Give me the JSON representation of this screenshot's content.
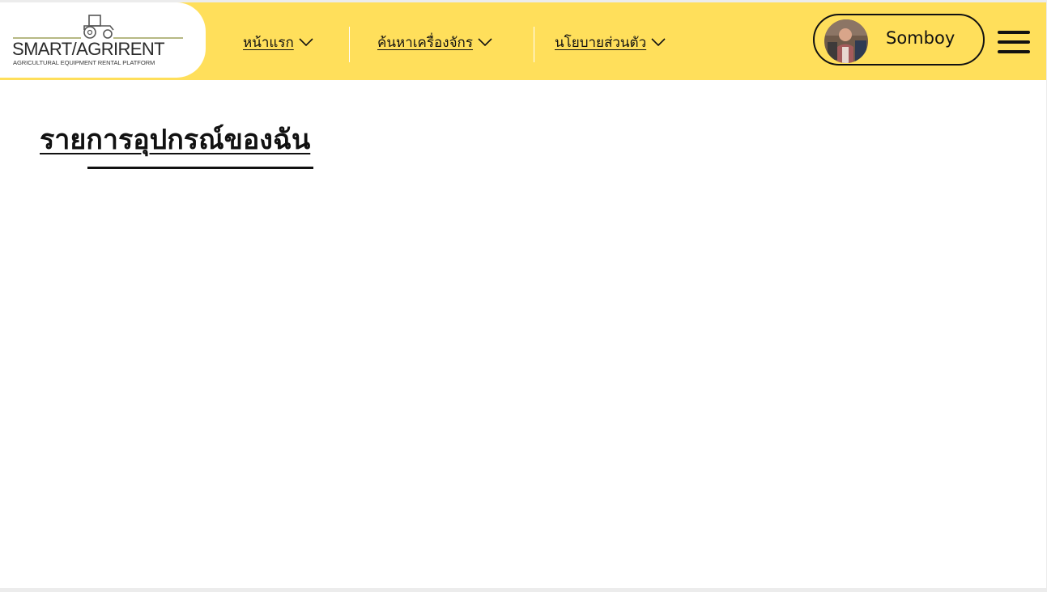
{
  "header": {
    "logo_title": "SMART/AGRIRENT",
    "logo_subtitle": "AGRICULTURAL EQUIPMENT RENTAL PLATFORM",
    "nav": [
      {
        "label": "หน้าแรก"
      },
      {
        "label": "ค้นหาเครื่องจักร"
      },
      {
        "label": "นโยบายส่วนตัว"
      }
    ],
    "user_name": "Somboy"
  },
  "main": {
    "title": "รายการอุปกรณ์ของฉัน"
  },
  "icons": {
    "logo": "tractor-icon",
    "dropdown": "chevron-down-icon",
    "menu": "hamburger-menu-icon"
  },
  "colors": {
    "header_bg": "#ffdf5b",
    "text": "#111111",
    "page_bg": "#ffffff"
  }
}
